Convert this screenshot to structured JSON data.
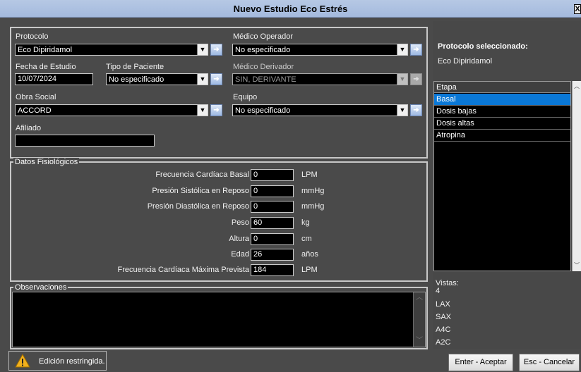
{
  "window": {
    "title": "Nuevo Estudio Eco Estrés",
    "close_glyph": "X"
  },
  "form": {
    "protocolo": {
      "label": "Protocolo",
      "value": "Eco Dipiridamol"
    },
    "medico_operador": {
      "label": "Médico Operador",
      "value": "No especificado"
    },
    "fecha_estudio": {
      "label": "Fecha de Estudio",
      "value": "10/07/2024"
    },
    "tipo_paciente": {
      "label": "Tipo de Paciente",
      "value": "No especificado"
    },
    "medico_derivador": {
      "label": "Médico Derivador",
      "value": "SIN, DERIVANTE"
    },
    "obra_social": {
      "label": "Obra Social",
      "value": "ACCORD"
    },
    "equipo": {
      "label": "Equipo",
      "value": "No especificado"
    },
    "afiliado": {
      "label": "Afiliado",
      "value": ""
    }
  },
  "datos_fisiologicos": {
    "title": "Datos Fisiológicos",
    "rows": [
      {
        "label": "Frecuencia Cardíaca Basal",
        "value": "0",
        "unit": "LPM"
      },
      {
        "label": "Presión Sistólica en Reposo",
        "value": "0",
        "unit": "mmHg"
      },
      {
        "label": "Presión Diastólica en Reposo",
        "value": "0",
        "unit": "mmHg"
      },
      {
        "label": "Peso",
        "value": "60",
        "unit": "kg"
      },
      {
        "label": "Altura",
        "value": "0",
        "unit": "cm"
      },
      {
        "label": "Edad",
        "value": "26",
        "unit": "años"
      },
      {
        "label": "Frecuencia Cardíaca Máxima Prevista",
        "value": "184",
        "unit": "LPM"
      }
    ]
  },
  "observaciones": {
    "title": "Observaciones",
    "value": ""
  },
  "right_panel": {
    "selected_title": "Protocolo seleccionado:",
    "selected_value": "Eco Dipiridamol",
    "etapa_header": "Etapa",
    "etapas": [
      "Basal",
      "Dosis bajas",
      "Dosis altas",
      "Atropina"
    ],
    "selected_etapa_index": 0,
    "vistas_label": "Vistas:",
    "vistas_count": "4",
    "vistas": [
      "LAX",
      "SAX",
      "A4C",
      "A2C"
    ]
  },
  "status": {
    "text": "Edición restringida."
  },
  "buttons": {
    "accept": "Enter - Aceptar",
    "cancel": "Esc - Cancelar"
  },
  "colors": {
    "accent": "#0a78d7",
    "background": "#4a4a4a",
    "titlebar": "#a4bade"
  }
}
